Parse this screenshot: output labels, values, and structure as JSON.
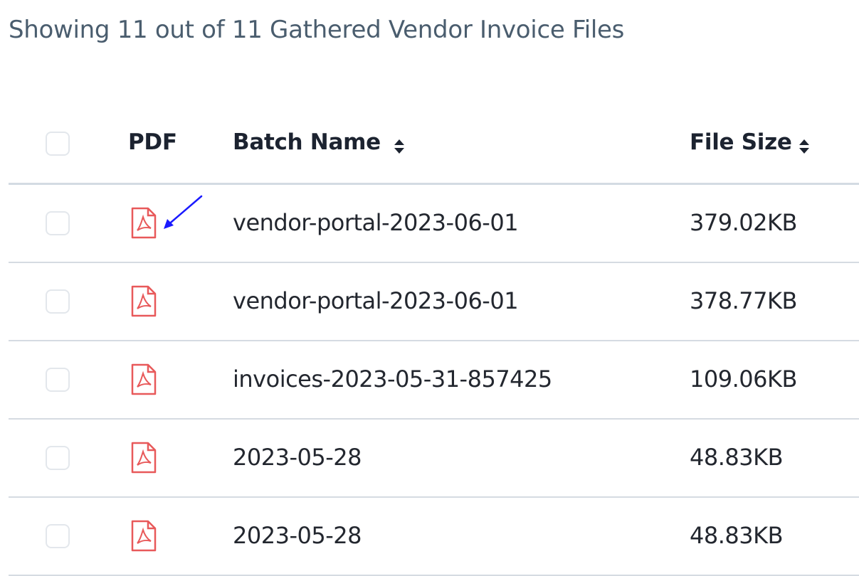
{
  "heading": "Showing 11 out of 11 Gathered Vendor Invoice Files",
  "columns": {
    "pdf": "PDF",
    "batch_name": "Batch Name",
    "file_size": "File Size"
  },
  "icons": {
    "pdf": "pdf-file-icon",
    "sort": "sort-icon",
    "annotation": "arrow-annotation"
  },
  "colors": {
    "pdf_icon": "#e8595a",
    "annotation_arrow": "#1a1aff",
    "heading": "#4a5d6e"
  },
  "rows": [
    {
      "batch_name": "vendor-portal-2023-06-01",
      "file_size": "379.02KB"
    },
    {
      "batch_name": "vendor-portal-2023-06-01",
      "file_size": "378.77KB"
    },
    {
      "batch_name": "invoices-2023-05-31-857425",
      "file_size": "109.06KB"
    },
    {
      "batch_name": "2023-05-28",
      "file_size": "48.83KB"
    },
    {
      "batch_name": "2023-05-28",
      "file_size": "48.83KB"
    }
  ]
}
